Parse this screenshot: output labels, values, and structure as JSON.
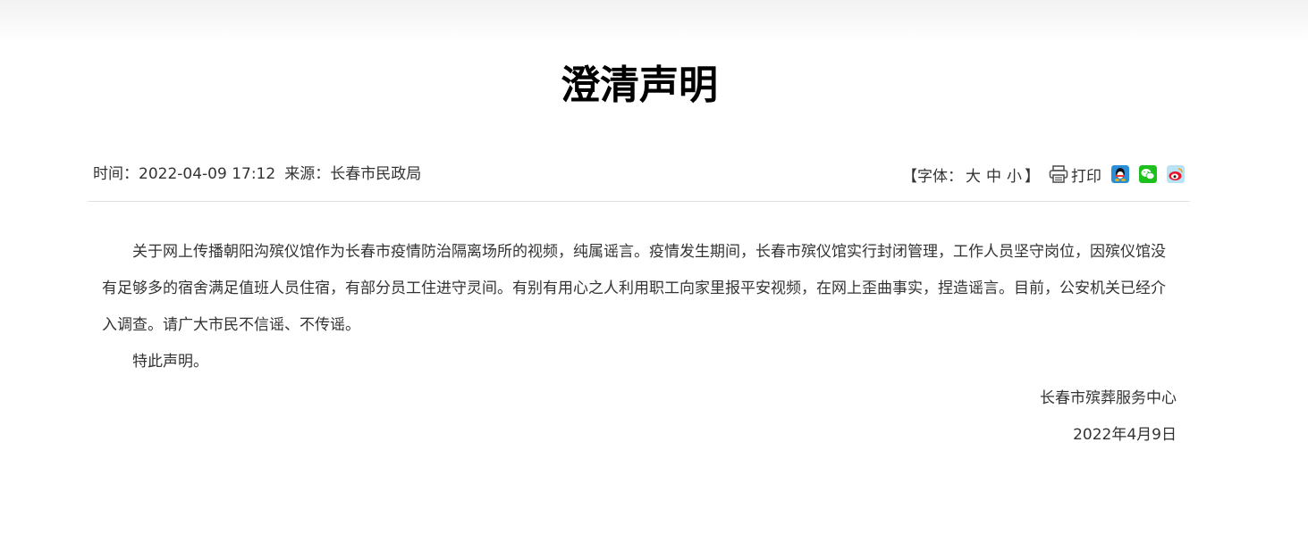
{
  "article": {
    "title": "澄清声明",
    "meta": {
      "time_label": "时间：",
      "time_value": "2022-04-09 17:12",
      "source_label": "来源：",
      "source_value": "长春市民政局"
    },
    "tools": {
      "font_label": "【字体：",
      "size_large": "大",
      "size_medium": "中",
      "size_small": "小",
      "font_close": "】",
      "print_label": "打印",
      "share_icons": [
        "qq-icon",
        "wechat-icon",
        "weibo-icon"
      ]
    },
    "paragraphs": [
      "关于网上传播朝阳沟殡仪馆作为长春市疫情防治隔离场所的视频，纯属谣言。疫情发生期间，长春市殡仪馆实行封闭管理，工作人员坚守岗位，因殡仪馆没有足够多的宿舍满足值班人员住宿，有部分员工住进守灵间。有别有用心之人利用职工向家里报平安视频，在网上歪曲事实，捏造谣言。目前，公安机关已经介入调查。请广大市民不信谣、不传谣。",
      "特此声明。"
    ],
    "signature": "长春市殡葬服务中心",
    "date": "2022年4月9日"
  },
  "colors": {
    "qq": "#2b8fd8",
    "wechat": "#1dc01d",
    "weibo": "#e6162d"
  }
}
